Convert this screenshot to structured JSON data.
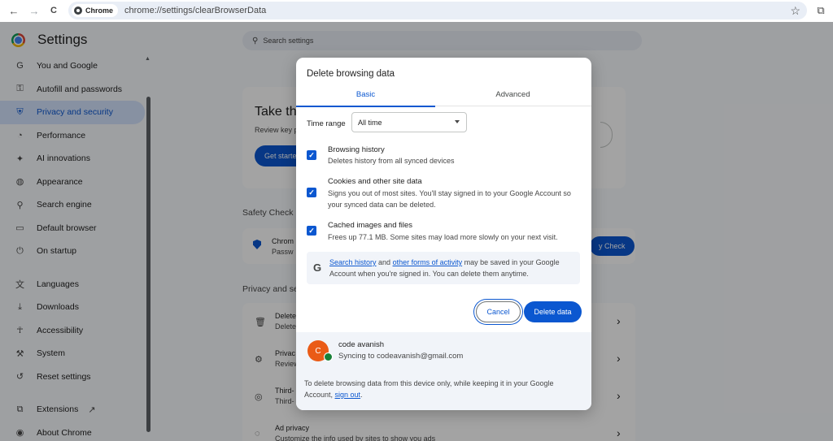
{
  "browser": {
    "back_icon": "←",
    "forward_icon": "→",
    "reload_icon": "C",
    "chip_label": "Chrome",
    "url": "chrome://settings/clearBrowserData",
    "bookmark_icon": "☆",
    "extensions_icon": "⧉"
  },
  "settings": {
    "title": "Settings",
    "search_placeholder": "Search settings",
    "nav": [
      {
        "label": "You and Google",
        "icon": "G"
      },
      {
        "label": "Autofill and passwords",
        "icon": "⚿"
      },
      {
        "label": "Privacy and security",
        "icon": "⛨"
      },
      {
        "label": "Performance",
        "icon": "◔"
      },
      {
        "label": "AI innovations",
        "icon": "✦"
      },
      {
        "label": "Appearance",
        "icon": "◍"
      },
      {
        "label": "Search engine",
        "icon": "⚲"
      },
      {
        "label": "Default browser",
        "icon": "▭"
      },
      {
        "label": "On startup",
        "icon": "⏻"
      },
      {
        "label": "Languages",
        "icon": "文"
      },
      {
        "label": "Downloads",
        "icon": "⤓"
      },
      {
        "label": "Accessibility",
        "icon": "☥"
      },
      {
        "label": "System",
        "icon": "⚒"
      },
      {
        "label": "Reset settings",
        "icon": "↺"
      },
      {
        "label": "Extensions",
        "icon": "⧉"
      },
      {
        "label": "About Chrome",
        "icon": "◉"
      }
    ],
    "promo": {
      "title": "Take th",
      "subtitle": "Review key p",
      "button": "Get starte"
    },
    "safety_check": {
      "heading": "Safety Check",
      "title": "Chrom",
      "subtitle": "Passw",
      "button": "y Check"
    },
    "privacy": {
      "heading": "Privacy and se",
      "rows": [
        {
          "title": "Delete",
          "subtitle": "Delete",
          "icon": "🗑"
        },
        {
          "title": "Privac",
          "subtitle": "Review",
          "icon": "⚙"
        },
        {
          "title": "Third-",
          "subtitle": "Third-",
          "icon": "◎"
        },
        {
          "title": "Ad privacy",
          "subtitle": "Customize the info used by sites to show you ads",
          "icon": "◌"
        }
      ]
    }
  },
  "dialog": {
    "title": "Delete browsing data",
    "tabs": [
      "Basic",
      "Advanced"
    ],
    "time_range_label": "Time range",
    "time_range_value": "All time",
    "options": [
      {
        "title": "Browsing history",
        "desc": "Deletes history from all synced devices",
        "checked": true
      },
      {
        "title": "Cookies and other site data",
        "desc": "Signs you out of most sites. You'll stay signed in to your Google Account so your synced data can be deleted.",
        "checked": true
      },
      {
        "title": "Cached images and files",
        "desc": "Frees up 77.1 MB. Some sites may load more slowly on your next visit.",
        "checked": true
      }
    ],
    "google_note": {
      "link1": "Search history",
      "mid": " and ",
      "link2": "other forms of activity",
      "rest": " may be saved in your Google Account when you're signed in. You can delete them anytime."
    },
    "cancel_label": "Cancel",
    "delete_label": "Delete data",
    "account": {
      "initial": "C",
      "name": "code avanish",
      "sync": "Syncing to codeavanish@gmail.com",
      "note_pre": "To delete browsing data from this device only, while keeping it in your Google Account, ",
      "sign_out": "sign out",
      "note_post": "."
    }
  },
  "colors": {
    "accent": "#0b57d0",
    "avatar": "#ea5b16",
    "sync_badge": "#188038"
  }
}
